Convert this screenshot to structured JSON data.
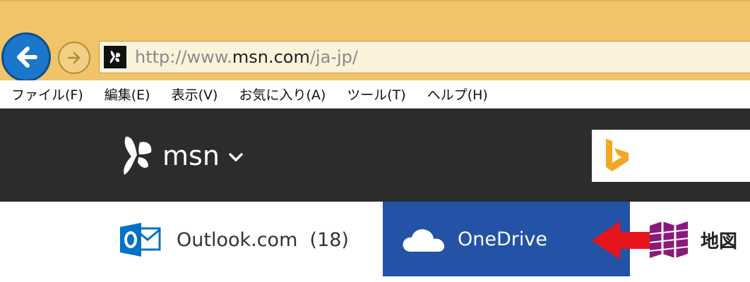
{
  "browser": {
    "url": {
      "scheme": "http://www.",
      "host": "msn.com",
      "path": "/ja-jp/"
    },
    "menu": [
      {
        "label": "ファイル(F)"
      },
      {
        "label": "編集(E)"
      },
      {
        "label": "表示(V)"
      },
      {
        "label": "お気に入り(A)"
      },
      {
        "label": "ツール(T)"
      },
      {
        "label": "ヘルプ(H)"
      }
    ],
    "icons": {
      "back": "back-arrow-icon",
      "forward": "forward-arrow-icon",
      "favicon": "msn-butterfly-icon"
    },
    "colors": {
      "chrome": "#f1c46a",
      "back_button": "#1a77c9"
    }
  },
  "msn": {
    "logo_text": "msn",
    "colors": {
      "header_bg": "#2c2c2c",
      "bing": "#f5a623"
    }
  },
  "services": {
    "outlook": {
      "label": "Outlook.com",
      "count": "(18)",
      "color": "#0072c6"
    },
    "onedrive": {
      "label": "OneDrive",
      "color": "#2352a6"
    },
    "maps": {
      "label": "地図",
      "color": "#8a1a7a"
    }
  },
  "annotation": {
    "arrow_color": "#e8141c"
  }
}
